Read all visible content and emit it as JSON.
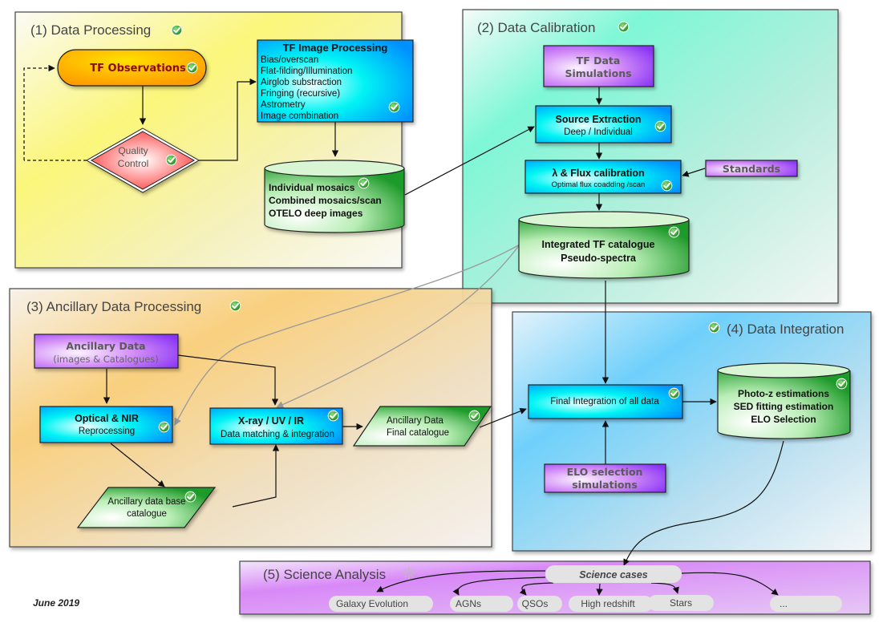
{
  "sections": {
    "s1": {
      "title": "(1) Data Processing",
      "status": "done"
    },
    "s2": {
      "title": "(2) Data  Calibration",
      "status": "done"
    },
    "s3": {
      "title": "(3) Ancillary Data  Processing",
      "status": "done"
    },
    "s4": {
      "title": "(4) Data  Integration",
      "status": "done"
    },
    "s5": {
      "title": "(5) Science Analysis",
      "status": "in-progress"
    }
  },
  "nodes": {
    "tf_observations": {
      "label": "TF Observations",
      "status": "done"
    },
    "quality_control": {
      "line1": "Quality",
      "line2": "Control",
      "status": "done"
    },
    "tf_image_processing": {
      "title": "TF Image Processing",
      "steps": [
        "Bias/overscan",
        "Flat-filding/Illumination",
        "Airglob substraction",
        "Fringing (recursive)",
        "Astrometry",
        "Image combination"
      ],
      "status": "done"
    },
    "mosaics_db": {
      "lines": [
        "Individual mosaics",
        "Combined mosaics/scan",
        "OTELO deep images"
      ],
      "status": "done"
    },
    "tf_data_simulations": {
      "line1": "TF Data",
      "line2": "Simulations"
    },
    "source_extraction": {
      "title": "Source Extraction",
      "subtitle": "Deep / Individual",
      "status": "done"
    },
    "flux_calibration": {
      "title": "λ &  Flux calibration",
      "subtitle": "Optimal flux coadding /scan",
      "status": "done"
    },
    "standards": {
      "label": "Standards"
    },
    "tf_catalogue_db": {
      "line1": "Integrated TF catalogue",
      "line2": "Pseudo-spectra",
      "status": "done"
    },
    "ancillary_data": {
      "title": "Ancillary Data",
      "subtitle": "(images & Catalogues)"
    },
    "optical_nir": {
      "title": "Optical & NIR",
      "subtitle": "Reprocessing",
      "status": "done"
    },
    "xray_uv_ir": {
      "title": "X-ray / UV / IR",
      "subtitle": "Data matching & integration",
      "status": "done"
    },
    "ancillary_final_catalogue": {
      "line1": "Ancillary Data",
      "line2": "Final catalogue",
      "status": "done"
    },
    "ancillary_base_catalogue": {
      "line1": "Ancillary data base",
      "line2": "catalogue",
      "status": "done"
    },
    "final_integration": {
      "label": "Final Integration of all data",
      "status": "done"
    },
    "elo_simulations": {
      "line1": "ELO selection",
      "line2": "simulations"
    },
    "photoz_db": {
      "lines": [
        "Photo-z estimations",
        "SED fitting estimation",
        "ELO Selection"
      ],
      "status": "done"
    },
    "science_cases": {
      "label": "Science cases"
    }
  },
  "science_case_items": [
    "Galaxy Evolution",
    "AGNs",
    "QSOs",
    "High redshift",
    "Stars",
    "..."
  ],
  "footer": {
    "date": "June 2019"
  },
  "colors": {
    "check_green": "#2e9e2e",
    "box_border": "#222222",
    "cyan_start": "#e8ffff",
    "cyan_mid": "#00f0f0",
    "cyan_end": "#0090ff",
    "purple_start": "#f4e6ff",
    "purple_end": "#8a3cf0",
    "green_start": "#f0fff0",
    "green_end": "#1e9a2a",
    "orange_start": "#ffd000",
    "orange_end": "#ff9a00",
    "red_diamond": "#ff5a5a"
  }
}
